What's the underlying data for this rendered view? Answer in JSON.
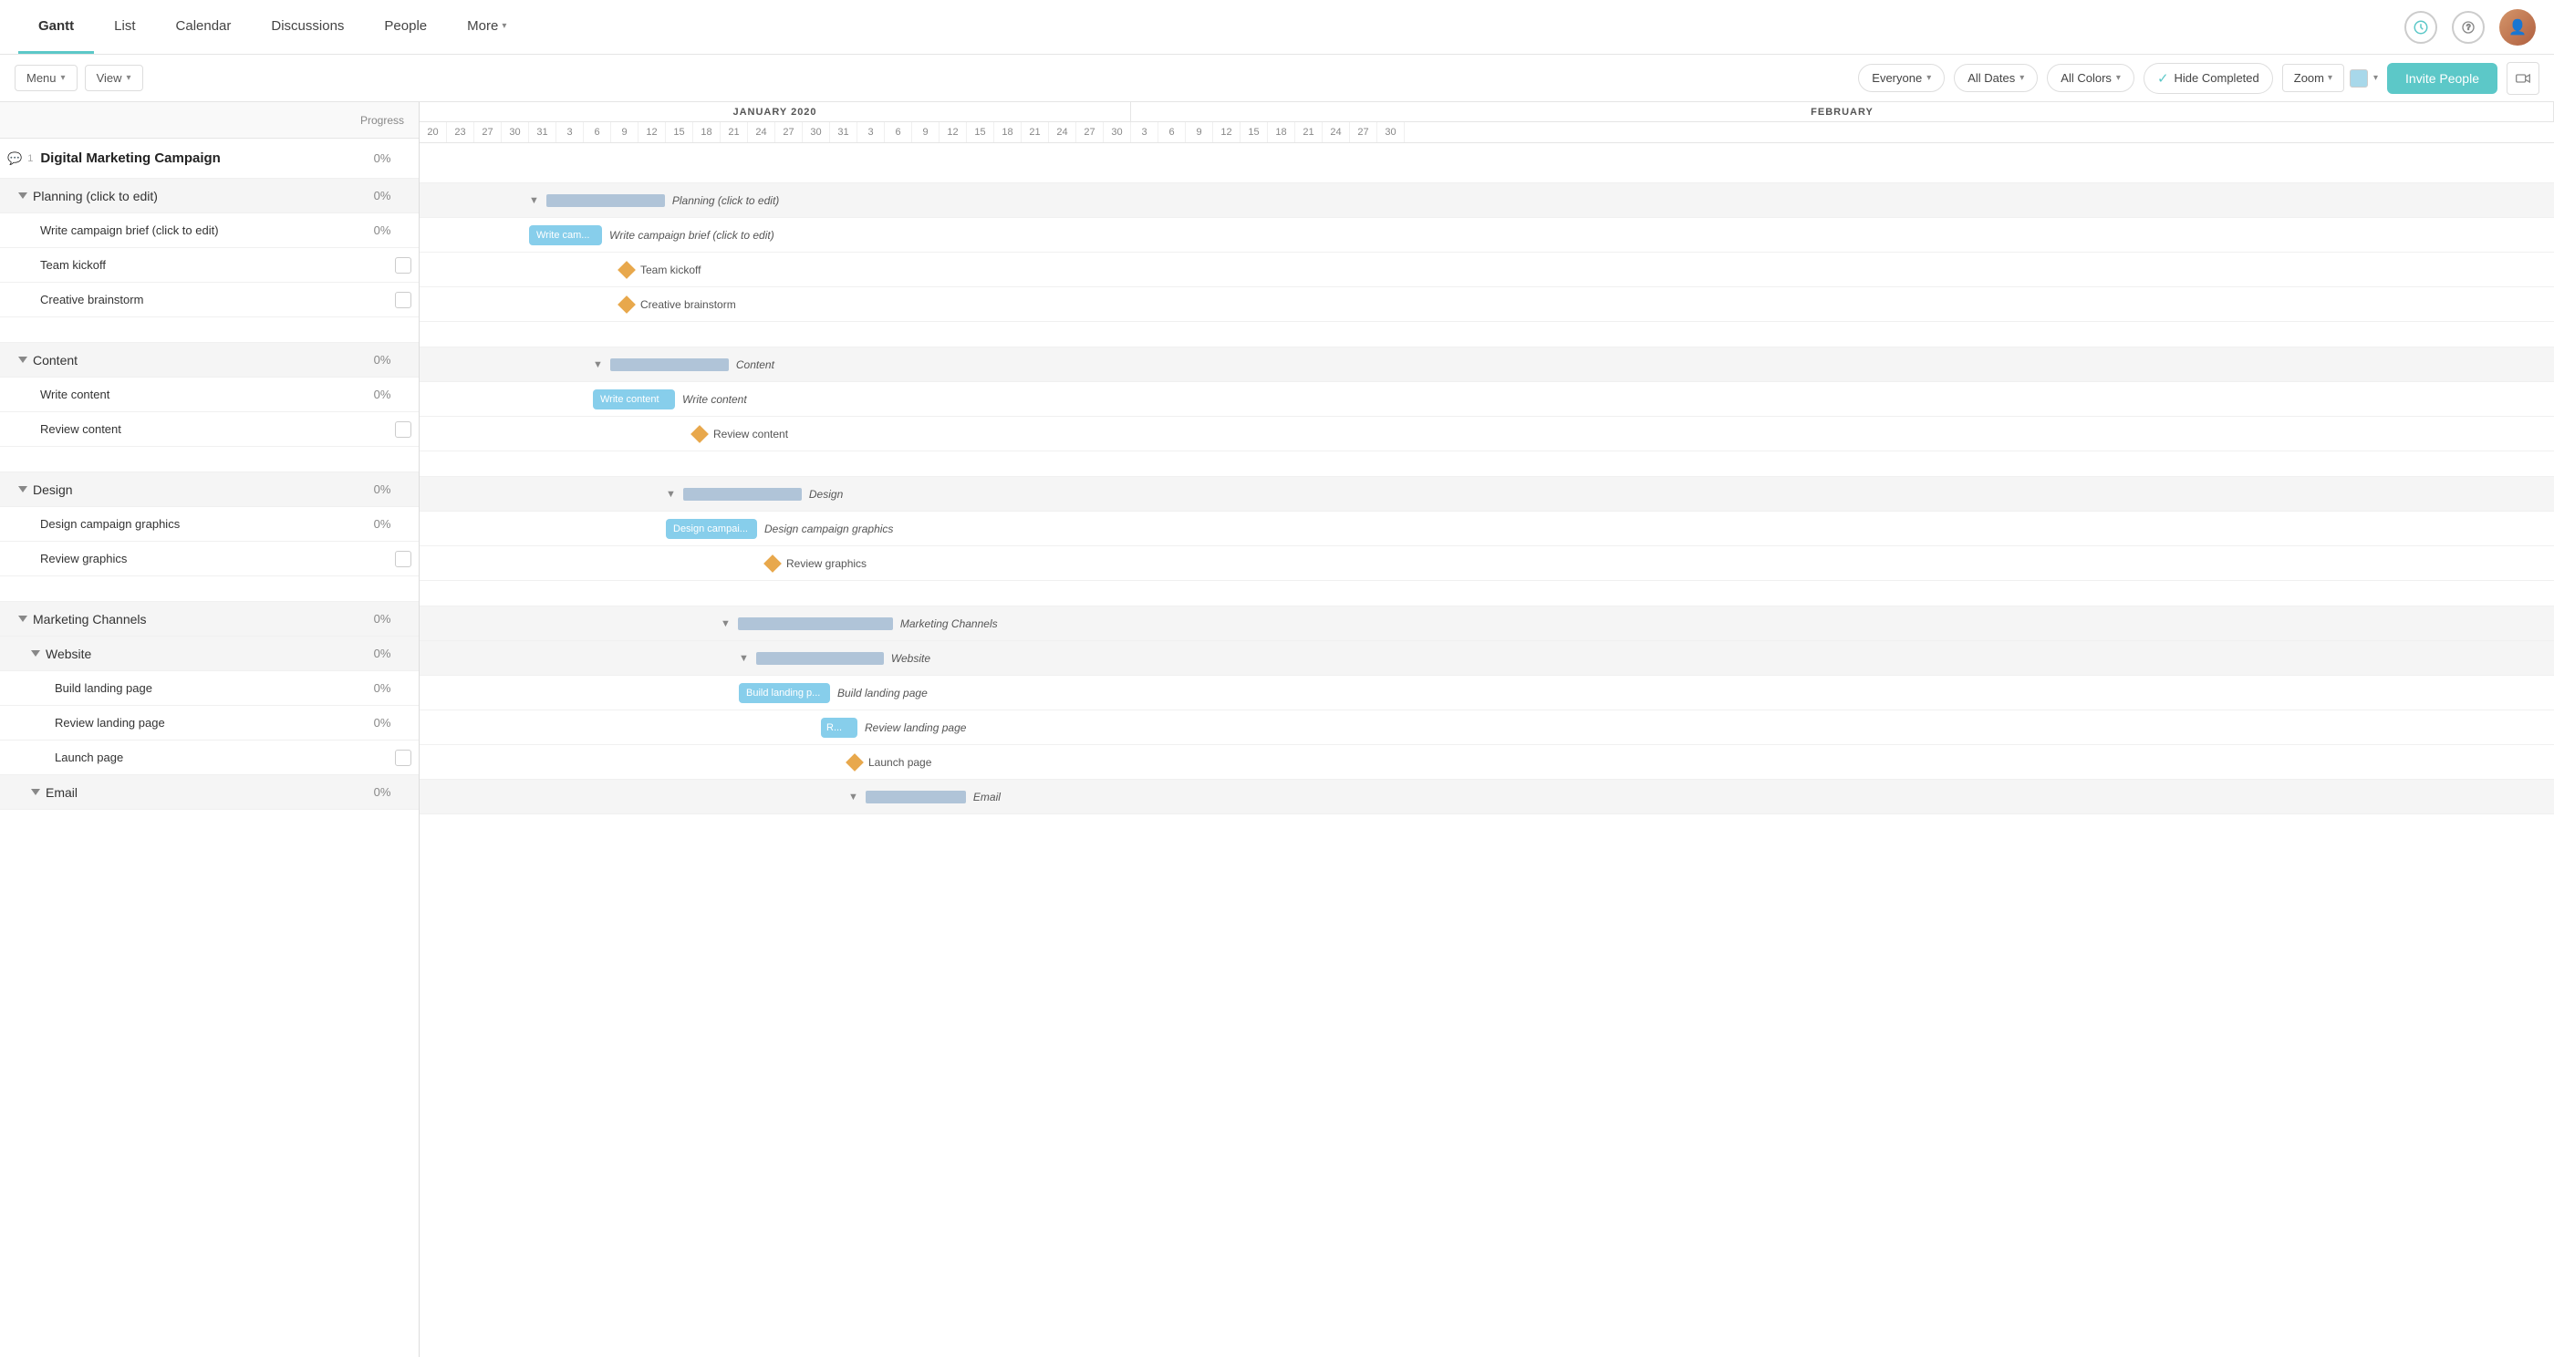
{
  "nav": {
    "tabs": [
      {
        "label": "Gantt",
        "active": true
      },
      {
        "label": "List",
        "active": false
      },
      {
        "label": "Calendar",
        "active": false
      },
      {
        "label": "Discussions",
        "active": false
      },
      {
        "label": "People",
        "active": false
      },
      {
        "label": "More",
        "active": false,
        "hasArrow": true
      }
    ]
  },
  "toolbar": {
    "menu_label": "Menu",
    "view_label": "View",
    "everyone_label": "Everyone",
    "all_dates_label": "All Dates",
    "all_colors_label": "All Colors",
    "hide_completed_label": "Hide Completed",
    "zoom_label": "Zoom",
    "invite_label": "Invite People"
  },
  "task_header": {
    "name_col": "",
    "progress_col": "Progress"
  },
  "tasks": [
    {
      "id": "project",
      "level": 0,
      "name": "Digital Marketing Campaign",
      "progress": "0%",
      "type": "project",
      "hasComment": true,
      "commentCount": "1"
    },
    {
      "id": "planning",
      "level": 1,
      "name": "Planning (click to edit)",
      "progress": "0%",
      "type": "group",
      "collapsed": false
    },
    {
      "id": "write-brief",
      "level": 2,
      "name": "Write campaign brief (click to edit)",
      "progress": "0%",
      "type": "task"
    },
    {
      "id": "team-kickoff",
      "level": 2,
      "name": "Team kickoff",
      "progress": "",
      "type": "milestone"
    },
    {
      "id": "creative-brain",
      "level": 2,
      "name": "Creative brainstorm",
      "progress": "",
      "type": "milestone"
    },
    {
      "id": "content",
      "level": 1,
      "name": "Content",
      "progress": "0%",
      "type": "group",
      "collapsed": false
    },
    {
      "id": "write-content",
      "level": 2,
      "name": "Write content",
      "progress": "0%",
      "type": "task"
    },
    {
      "id": "review-content",
      "level": 2,
      "name": "Review content",
      "progress": "",
      "type": "milestone"
    },
    {
      "id": "design",
      "level": 1,
      "name": "Design",
      "progress": "0%",
      "type": "group",
      "collapsed": false
    },
    {
      "id": "design-graphics",
      "level": 2,
      "name": "Design campaign graphics",
      "progress": "0%",
      "type": "task"
    },
    {
      "id": "review-graphics",
      "level": 2,
      "name": "Review graphics",
      "progress": "",
      "type": "milestone"
    },
    {
      "id": "marketing-channels",
      "level": 1,
      "name": "Marketing Channels",
      "progress": "0%",
      "type": "group",
      "collapsed": false
    },
    {
      "id": "website",
      "level": 2,
      "name": "Website",
      "progress": "0%",
      "type": "group",
      "collapsed": false
    },
    {
      "id": "build-landing",
      "level": 3,
      "name": "Build landing page",
      "progress": "0%",
      "type": "task"
    },
    {
      "id": "review-landing",
      "level": 3,
      "name": "Review landing page",
      "progress": "0%",
      "type": "task"
    },
    {
      "id": "launch-page",
      "level": 3,
      "name": "Launch page",
      "progress": "",
      "type": "milestone"
    },
    {
      "id": "email",
      "level": 2,
      "name": "Email",
      "progress": "0%",
      "type": "group",
      "collapsed": false
    }
  ],
  "gantt": {
    "months": [
      {
        "label": "JANUARY 2020",
        "days": [
          20,
          23,
          27,
          30,
          31,
          3,
          6,
          9,
          12,
          15,
          18,
          21,
          24,
          27,
          30,
          3,
          6,
          9,
          12,
          15,
          18,
          21,
          24,
          27,
          30
        ]
      },
      {
        "label": "FEBRUARY",
        "days": [
          3,
          6,
          9,
          12,
          15,
          18,
          21,
          24,
          27
        ]
      }
    ],
    "days_row": [
      20,
      23,
      27,
      30,
      31,
      3,
      6,
      9,
      12,
      15,
      18,
      21,
      24,
      27,
      30,
      31,
      3,
      6,
      9,
      12,
      15,
      18,
      21,
      24,
      27,
      30,
      3,
      6,
      9,
      12,
      15,
      18,
      21,
      24,
      27,
      30
    ]
  }
}
